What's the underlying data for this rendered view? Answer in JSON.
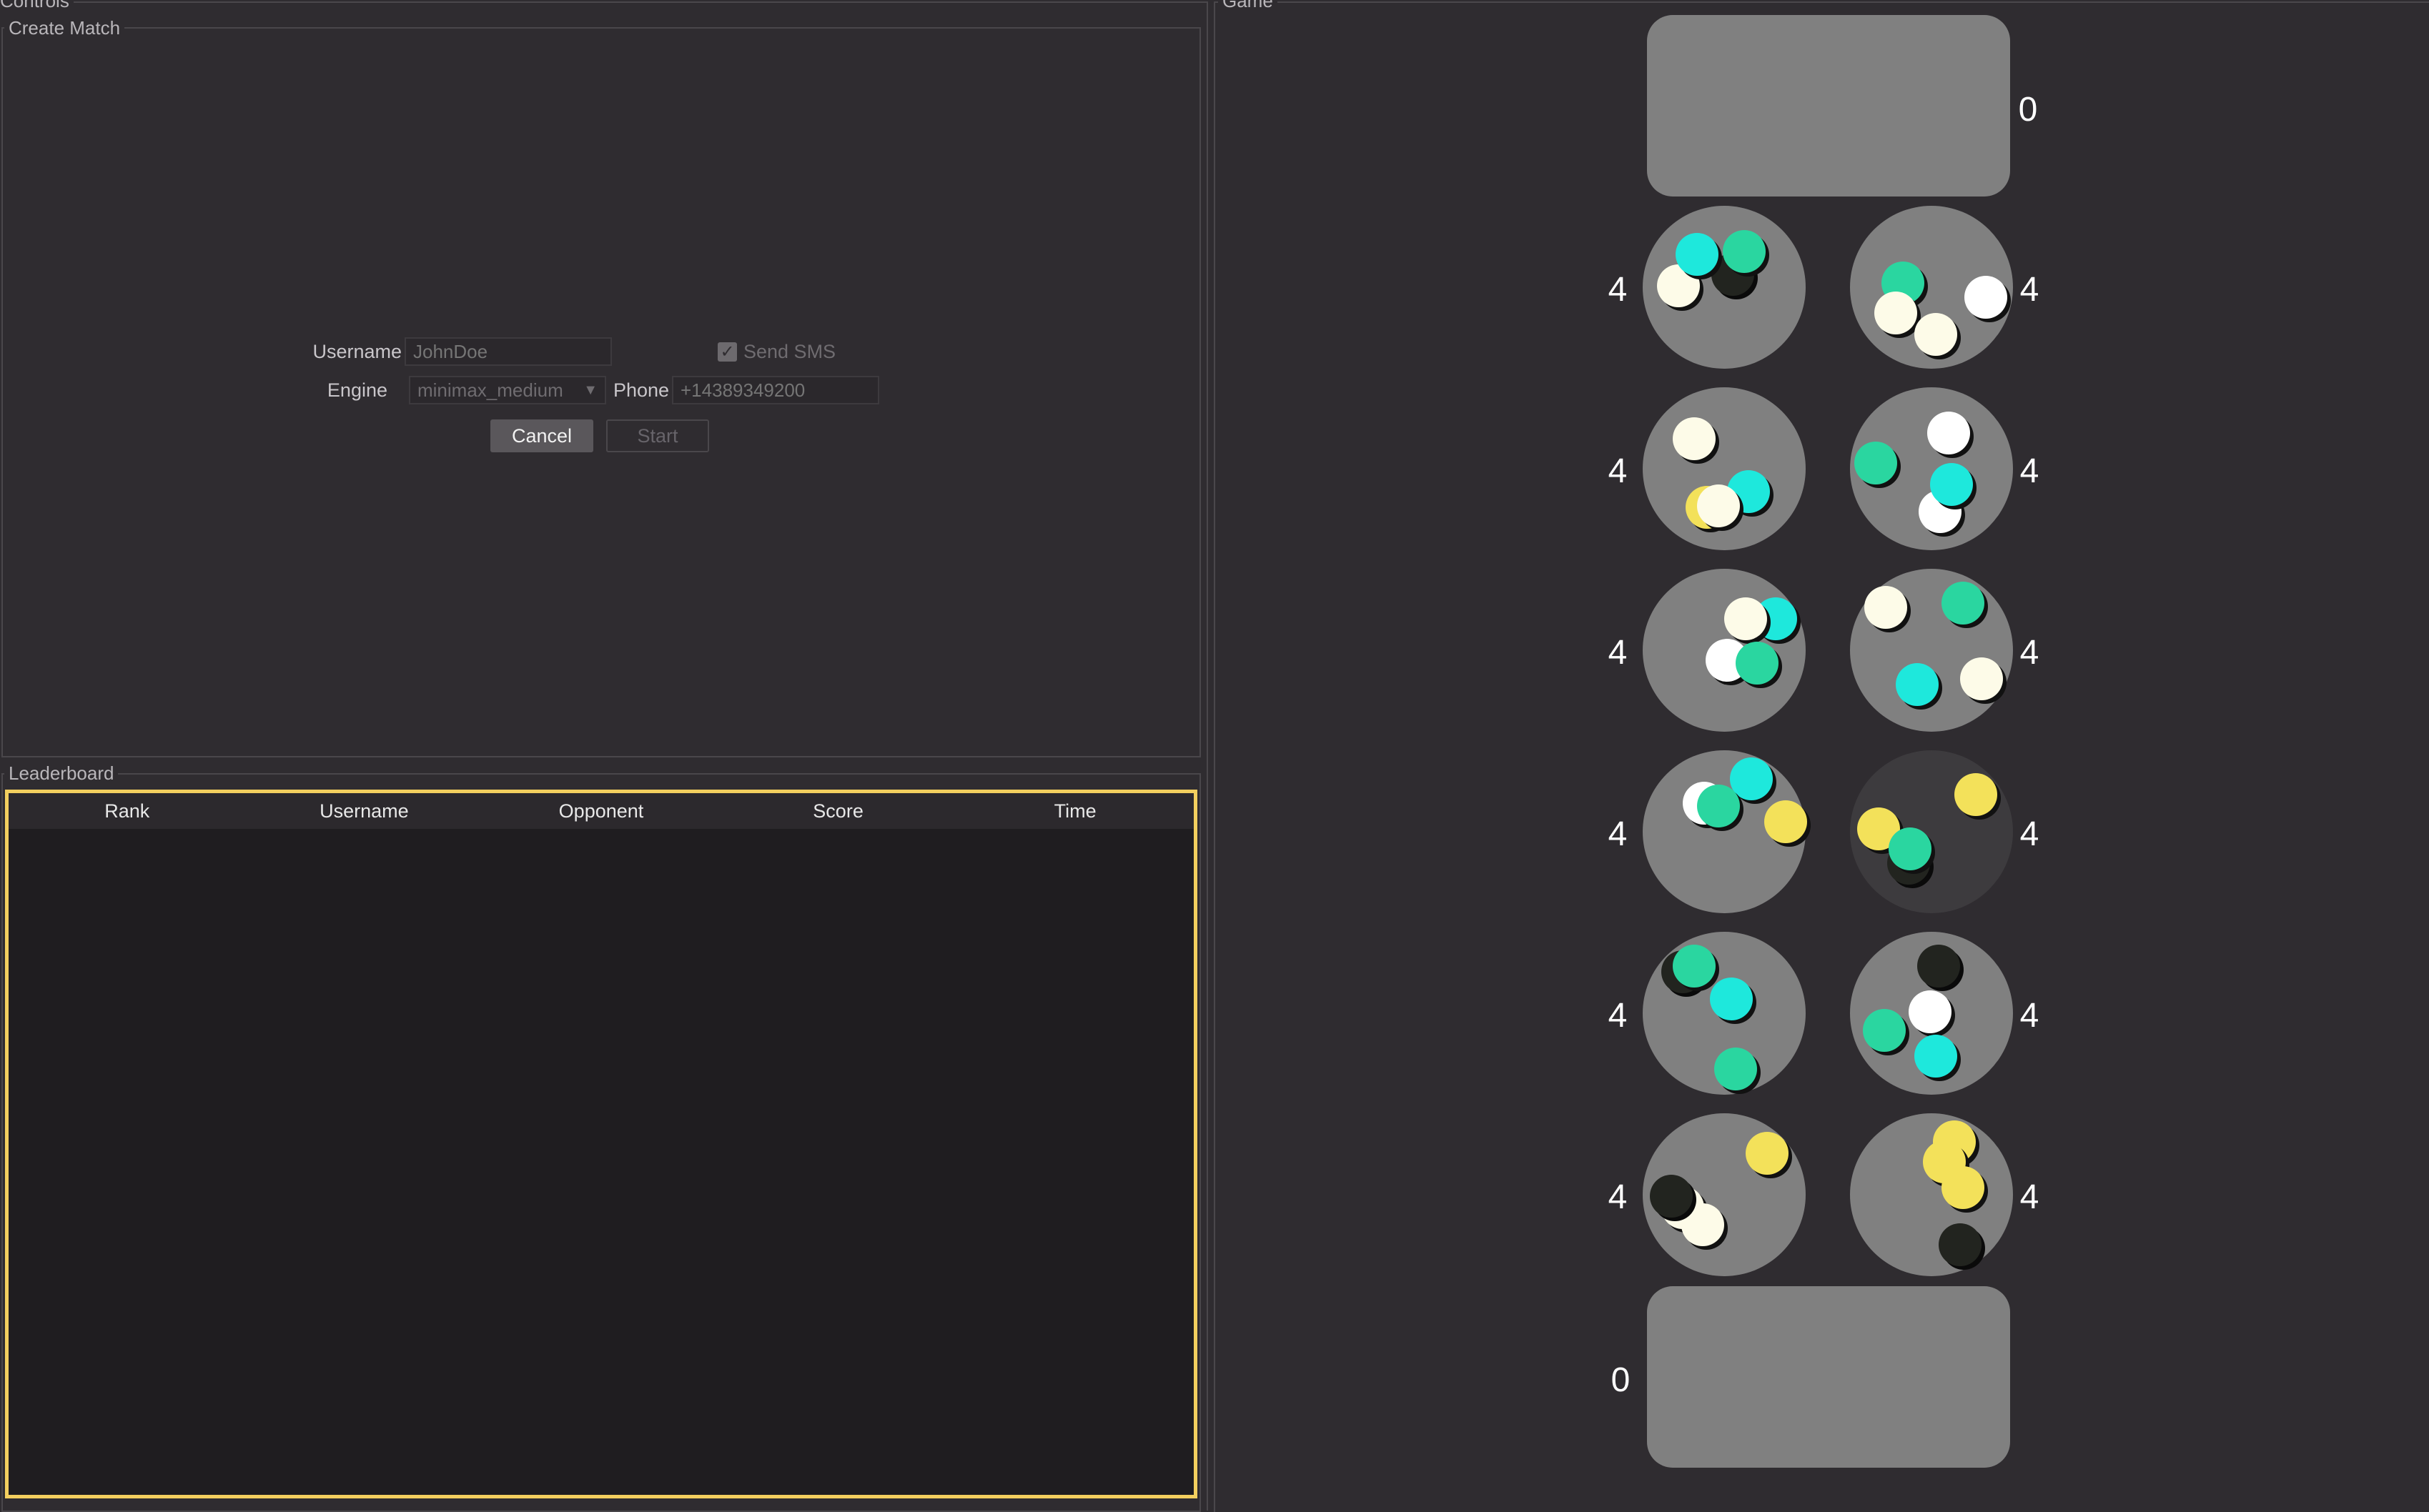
{
  "controls": {
    "title": "Controls"
  },
  "create_match": {
    "title": "Create Match",
    "username_label": "Username",
    "username_placeholder": "JohnDoe",
    "send_sms_label": "Send SMS",
    "send_sms_checked": true,
    "engine_label": "Engine",
    "engine_value": "minimax_medium",
    "phone_label": "Phone",
    "phone_placeholder": "+14389349200",
    "cancel_label": "Cancel",
    "start_label": "Start"
  },
  "leaderboard": {
    "title": "Leaderboard",
    "columns": [
      "Rank",
      "Username",
      "Opponent",
      "Score",
      "Time"
    ],
    "rows": []
  },
  "game": {
    "title": "Game",
    "top_store": 0,
    "bottom_store": 0,
    "left_pits": [
      4,
      4,
      4,
      4,
      4,
      4
    ],
    "right_pits": [
      4,
      4,
      4,
      4,
      4,
      4
    ],
    "highlighted_pit": "right-4",
    "colors": {
      "board": "#808080",
      "highlight_pit": "#3d3b3e",
      "stone_cyan": "#1ee8dc",
      "stone_teal": "#2ad6a0",
      "stone_white": "#fdfbe8",
      "stone_yellow": "#f3e15a",
      "stone_black": "#22241f",
      "leaderboard_border": "#f3cf5f"
    }
  }
}
